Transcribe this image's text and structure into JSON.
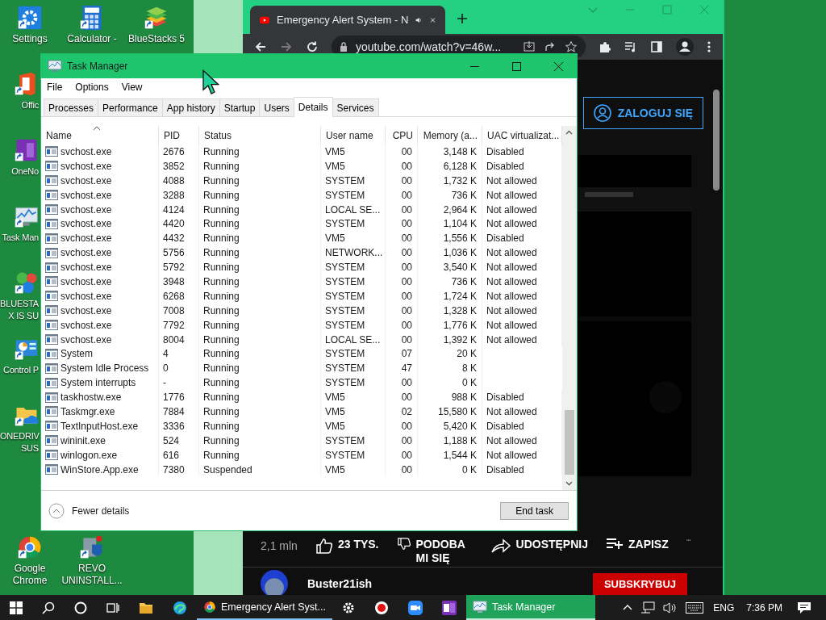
{
  "desktop_icons": [
    {
      "label_lines": [
        "Settings"
      ]
    },
    {
      "label_lines": [
        "Calculator -"
      ]
    },
    {
      "label_lines": [
        "BlueStacks 5"
      ]
    },
    {
      "label_lines": [
        "Offic"
      ]
    },
    {
      "label_lines": [
        "OneNo"
      ]
    },
    {
      "label_lines": [
        "Task Man"
      ]
    },
    {
      "label_lines": [
        "BLUESTA",
        "X IS SU"
      ]
    },
    {
      "label_lines": [
        "Control P"
      ]
    },
    {
      "label_lines": [
        "ONEDRIV",
        "SUS"
      ]
    },
    {
      "label_lines": [
        "Google",
        "Chrome"
      ]
    },
    {
      "label_lines": [
        "REVO",
        "UNINSTALL..."
      ]
    }
  ],
  "browser": {
    "tab_title": "Emergency Alert System - N",
    "address": "youtube.com/watch?v=46w...",
    "login_button": "ZALOGUJ SIĘ",
    "views": "2,1 mln",
    "likes": "23 TYS.",
    "dislike": "PODOBA MI SIĘ",
    "share": "UDOSTĘPNIJ",
    "save": "ZAPISZ",
    "channel": "Buster21ish",
    "subscribe": "SUBSKRYBUJ"
  },
  "task_manager": {
    "title": "Task Manager",
    "menu": [
      "File",
      "Options",
      "View"
    ],
    "tabs": [
      {
        "label": "Processes",
        "selected": false
      },
      {
        "label": "Performance",
        "selected": false
      },
      {
        "label": "App history",
        "selected": false
      },
      {
        "label": "Startup",
        "selected": false
      },
      {
        "label": "Users",
        "selected": false
      },
      {
        "label": "Details",
        "selected": true
      },
      {
        "label": "Services",
        "selected": false
      }
    ],
    "columns": [
      "Name",
      "PID",
      "Status",
      "User name",
      "CPU",
      "Memory (a...",
      "UAC virtualizat..."
    ],
    "rows": [
      {
        "cells": [
          "svchost.exe",
          "2676",
          "Running",
          "VM5",
          "00",
          "3,148 K",
          "Disabled"
        ]
      },
      {
        "cells": [
          "svchost.exe",
          "3852",
          "Running",
          "VM5",
          "00",
          "6,128 K",
          "Disabled"
        ]
      },
      {
        "cells": [
          "svchost.exe",
          "4088",
          "Running",
          "SYSTEM",
          "00",
          "1,732 K",
          "Not allowed"
        ]
      },
      {
        "cells": [
          "svchost.exe",
          "3288",
          "Running",
          "SYSTEM",
          "00",
          "736 K",
          "Not allowed"
        ]
      },
      {
        "cells": [
          "svchost.exe",
          "4124",
          "Running",
          "LOCAL SE...",
          "00",
          "2,964 K",
          "Not allowed"
        ]
      },
      {
        "cells": [
          "svchost.exe",
          "4420",
          "Running",
          "SYSTEM",
          "00",
          "1,104 K",
          "Not allowed"
        ]
      },
      {
        "cells": [
          "svchost.exe",
          "4432",
          "Running",
          "VM5",
          "00",
          "1,556 K",
          "Disabled"
        ]
      },
      {
        "cells": [
          "svchost.exe",
          "5756",
          "Running",
          "NETWORK...",
          "00",
          "1,036 K",
          "Not allowed"
        ]
      },
      {
        "cells": [
          "svchost.exe",
          "5792",
          "Running",
          "SYSTEM",
          "00",
          "3,540 K",
          "Not allowed"
        ]
      },
      {
        "cells": [
          "svchost.exe",
          "3948",
          "Running",
          "SYSTEM",
          "00",
          "736 K",
          "Not allowed"
        ]
      },
      {
        "cells": [
          "svchost.exe",
          "6268",
          "Running",
          "SYSTEM",
          "00",
          "1,724 K",
          "Not allowed"
        ]
      },
      {
        "cells": [
          "svchost.exe",
          "7008",
          "Running",
          "SYSTEM",
          "00",
          "1,328 K",
          "Not allowed"
        ]
      },
      {
        "cells": [
          "svchost.exe",
          "7792",
          "Running",
          "SYSTEM",
          "00",
          "1,776 K",
          "Not allowed"
        ]
      },
      {
        "cells": [
          "svchost.exe",
          "8004",
          "Running",
          "LOCAL SE...",
          "00",
          "1,392 K",
          "Not allowed"
        ]
      },
      {
        "cells": [
          "System",
          "4",
          "Running",
          "SYSTEM",
          "07",
          "20 K"
        ]
      },
      {
        "cells": [
          "System Idle Process",
          "0",
          "Running",
          "SYSTEM",
          "47",
          "8 K"
        ]
      },
      {
        "cells": [
          "System interrupts",
          "-",
          "Running",
          "SYSTEM",
          "00",
          "0 K"
        ]
      },
      {
        "cells": [
          "taskhostw.exe",
          "1776",
          "Running",
          "VM5",
          "00",
          "988 K",
          "Disabled"
        ]
      },
      {
        "cells": [
          "Taskmgr.exe",
          "7884",
          "Running",
          "VM5",
          "02",
          "15,580 K",
          "Not allowed"
        ]
      },
      {
        "cells": [
          "TextInputHost.exe",
          "3336",
          "Running",
          "VM5",
          "00",
          "5,420 K",
          "Disabled"
        ]
      },
      {
        "cells": [
          "wininit.exe",
          "524",
          "Running",
          "SYSTEM",
          "00",
          "1,188 K",
          "Not allowed"
        ]
      },
      {
        "cells": [
          "winlogon.exe",
          "616",
          "Running",
          "SYSTEM",
          "00",
          "1,544 K",
          "Not allowed"
        ]
      },
      {
        "cells": [
          "WinStore.App.exe",
          "7380",
          "Suspended",
          "VM5",
          "00",
          "0 K",
          "Disabled"
        ]
      }
    ],
    "fewer_details": "Fewer details",
    "end_task": "End task"
  },
  "taskbar": {
    "apps": [
      {
        "label": "Emergency Alert Syst...",
        "selected": false
      },
      {
        "label": "Task Manager",
        "selected": true
      }
    ],
    "language": "ENG",
    "time": "7:36 PM"
  }
}
